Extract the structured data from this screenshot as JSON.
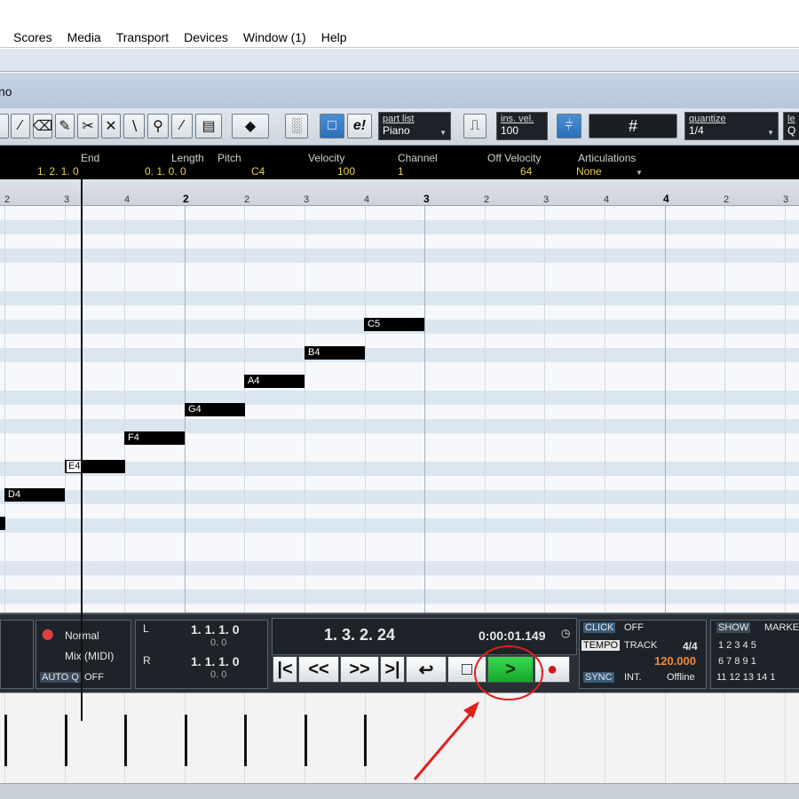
{
  "menu": [
    "Scores",
    "Media",
    "Transport",
    "Devices",
    "Window (1)",
    "Help"
  ],
  "window_title": "no",
  "toolbar": {
    "part_list_label": "part list",
    "part_list_value": "Piano",
    "ins_vel_label": "ins. vel.",
    "ins_vel_value": "100",
    "grid_glyph": "#",
    "quantize_label": "quantize",
    "quantize_value": "1/4",
    "length_label_partial": "le",
    "length_value_partial": "Q"
  },
  "infoline": {
    "headers": [
      "End",
      "Length",
      "Pitch",
      "Velocity",
      "Channel",
      "Off Velocity",
      "Articulations"
    ],
    "values": [
      "1. 2. 1.   0",
      "0. 1. 0.   0",
      "C4",
      "100",
      "1",
      "64",
      "None"
    ]
  },
  "ruler": {
    "ticks": [
      "2",
      "3",
      "4",
      "2",
      "2",
      "3",
      "4",
      "3",
      "2",
      "3",
      "4",
      "4",
      "2",
      "3"
    ]
  },
  "notes": [
    "D4",
    "E4",
    "F4",
    "G4",
    "A4",
    "B4",
    "C5"
  ],
  "transport": {
    "mode": "Normal",
    "mix": "Mix (MIDI)",
    "auto_q": "AUTO Q",
    "auto_q_state": "OFF",
    "left_locator": "1. 1. 1.   0",
    "left_sub": "0.   0",
    "right_locator": "1. 1. 1.   0",
    "right_sub": "0.   0",
    "position": "1. 3. 2.  24",
    "time": "0:00:01.149",
    "click_label": "CLICK",
    "click_state": "OFF",
    "tempo_label": "TEMPO",
    "tempo_mode": "TRACK",
    "signature": "4/4",
    "tempo_value": "120.000",
    "sync_label": "SYNC",
    "sync_mode": "INT.",
    "sync_state": "Offline",
    "show_label": "SHOW",
    "marker_label": "MARKE",
    "marker_numbers_row1": "1  2  3  4  5",
    "marker_numbers_row2": "6  7  8  9  1",
    "marker_numbers_row3": "11 12 13 14 1"
  },
  "annotation_color": "#e0201c"
}
